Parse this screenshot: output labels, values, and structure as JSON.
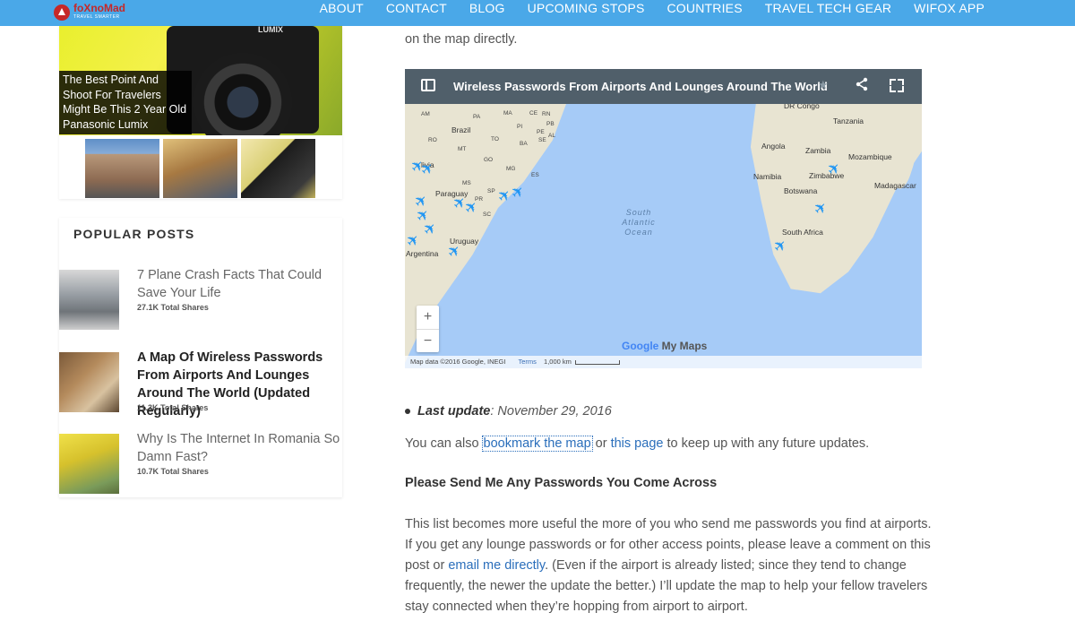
{
  "site": {
    "logo_text": "foXnoMad",
    "logo_sub": "TRAVEL SMARTER"
  },
  "nav": {
    "items": [
      "ABOUT",
      "CONTACT",
      "BLOG",
      "UPCOMING STOPS",
      "COUNTRIES",
      "TRAVEL TECH GEAR",
      "WIFOX APP"
    ]
  },
  "slider": {
    "caption": "The Best Point And Shoot For Travelers Might Be This 2 Year Old Panasonic Lumix",
    "camera_brand": "LUMIX"
  },
  "popular": {
    "heading": "POPULAR POSTS",
    "posts": [
      {
        "title": "7 Plane Crash Facts That Could Save Your Life",
        "shares": "27.1K Total Shares"
      },
      {
        "title": "A Map Of Wireless Passwords From Airports And Lounges Around The World (Updated Regularly)",
        "shares": "11.3K Total Shares"
      },
      {
        "title": "Why Is The Internet In Romania So Damn Fast?",
        "shares": "10.7K Total Shares"
      }
    ]
  },
  "article": {
    "intro_tail": "on the map directly.",
    "map": {
      "title": "Wireless Passwords From Airports And Lounges Around The World",
      "labels": {
        "brazil": "Brazil",
        "paraguay": "Paraguay",
        "argentina": "Argentina",
        "uruguay": "Uruguay",
        "angola": "Angola",
        "zambia": "Zambia",
        "namibia": "Namibia",
        "botswana": "Botswana",
        "zimbabwe": "Zimbabwe",
        "mozambique": "Mozambique",
        "madagascar": "Madagascar",
        "south_africa": "South Africa",
        "tanzania": "Tanzania",
        "dr_congo": "DR Congo",
        "bolivia": "livia",
        "ocean": "South Atlantic Ocean",
        "am": "AM",
        "pa": "PA",
        "ma": "MA",
        "ce": "CE",
        "rn": "RN",
        "pi": "PI",
        "pb": "PB",
        "pe": "PE",
        "al": "AL",
        "ro": "RO",
        "to": "TO",
        "ba": "BA",
        "se": "SE",
        "mt": "MT",
        "go": "GO",
        "mg": "MG",
        "ms": "MS",
        "es": "ES",
        "sp": "SP",
        "rj": "RJ",
        "pr": "PR",
        "sc": "SC"
      },
      "zoom_in": "+",
      "zoom_out": "−",
      "brand": "Google",
      "brand_tail": " My Maps",
      "attribution": "Map data ©2016 Google, INEGI",
      "terms": "Terms",
      "scale": "1,000 km"
    },
    "last_update_label": "Last update",
    "last_update_value": ": November 29, 2016",
    "p1_start": "You can also ",
    "p1_link1": "bookmark the map",
    "p1_mid": " or ",
    "p1_link2": "this page",
    "p1_end": " to keep up with any future updates.",
    "heading": "Please Send Me Any Passwords You Come Across",
    "p2_start": "This list becomes more useful the more of you who send me passwords you find at airports. If you get any lounge passwords or for other access points, please leave a comment on this post or ",
    "p2_link": "email me directly",
    "p2_end": ". (Even if the airport is already listed; since they tend to change frequently, the newer the update the better.) I’ll update the map to help your fellow travelers stay connected when they’re hopping from airport to airport."
  },
  "colors": {
    "nav_bg": "#4aa8e8",
    "link": "#2a6ebb",
    "map_header": "#505f6a",
    "map_water": "#a6cbf7",
    "marker": "#2196f3"
  },
  "icons": {
    "map_sidebar": "sidebar-icon",
    "share": "share-icon",
    "fullscreen": "fullscreen-icon",
    "marker": "airplane-icon"
  }
}
